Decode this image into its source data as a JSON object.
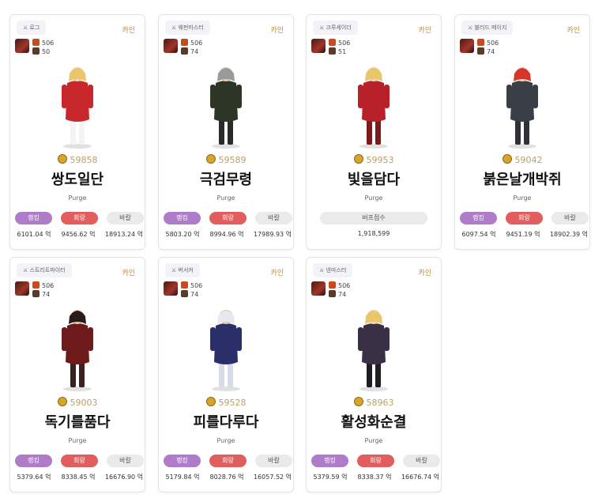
{
  "cards": [
    {
      "job": "로그",
      "adv_label": "카인",
      "fame": "506",
      "level": "50",
      "score": "59858",
      "name": "쌍도일단",
      "guild": "Purge",
      "buttons": [
        "랭킹",
        "회랑",
        "바칼"
      ],
      "values": [
        "6101.04 억",
        "9456.62 억",
        "18913.24 억"
      ],
      "colors": {
        "hair": "#e9c66a",
        "coat": "#c8272b",
        "skin": "#f3d2b8",
        "leg": "#f4f4f4"
      }
    },
    {
      "job": "웨펀마스터",
      "adv_label": "카인",
      "fame": "506",
      "level": "74",
      "score": "59589",
      "name": "극검무령",
      "guild": "Purge",
      "buttons": [
        "랭킹",
        "회랑",
        "바칼"
      ],
      "values": [
        "5803.20 억",
        "8994.96 억",
        "17989.93 억"
      ],
      "colors": {
        "hair": "#9a9a9a",
        "coat": "#2c3526",
        "skin": "#e9c9a8",
        "leg": "#2a2a2a"
      }
    },
    {
      "job": "크루세이더",
      "adv_label": "카인",
      "fame": "506",
      "level": "51",
      "score": "59953",
      "name": "빛을담다",
      "guild": "Purge",
      "buff_label": "버프점수",
      "buff_value": "1,918,599",
      "colors": {
        "hair": "#e9c66a",
        "coat": "#b8202a",
        "skin": "#f3d2b8",
        "leg": "#7a1a1a"
      }
    },
    {
      "job": "블러드 메이지",
      "adv_label": "카인",
      "fame": "506",
      "level": "74",
      "score": "59042",
      "name": "붉은날개박쥐",
      "guild": "Purge",
      "buttons": [
        "랭킹",
        "회랑",
        "바칼"
      ],
      "values": [
        "6097.54 억",
        "9451.19 억",
        "18902.39 억"
      ],
      "colors": {
        "hair": "#d8352a",
        "coat": "#3a3f47",
        "skin": "#f3d2b8",
        "leg": "#2e3238"
      }
    },
    {
      "job": "스트리트파이터",
      "adv_label": "카인",
      "fame": "506",
      "level": "74",
      "score": "59003",
      "name": "독기를품다",
      "guild": "Purge",
      "buttons": [
        "랭킹",
        "회랑",
        "바칼"
      ],
      "values": [
        "5379.64 억",
        "8338.45 억",
        "16676.90 억"
      ],
      "colors": {
        "hair": "#2a1a1a",
        "coat": "#6e1a1a",
        "skin": "#e9c9a8",
        "leg": "#3a2020"
      }
    },
    {
      "job": "버서커",
      "adv_label": "카인",
      "fame": "506",
      "level": "74",
      "score": "59528",
      "name": "피를다루다",
      "guild": "Purge",
      "buttons": [
        "랭킹",
        "회랑",
        "바칼"
      ],
      "values": [
        "5179.84 억",
        "8028.76 억",
        "16057.52 억"
      ],
      "colors": {
        "hair": "#e8e8f0",
        "coat": "#2a2f6a",
        "skin": "#e9c9a8",
        "leg": "#d8dbe8"
      }
    },
    {
      "job": "넨마스터",
      "adv_label": "카인",
      "fame": "506",
      "level": "74",
      "score": "58963",
      "name": "활성화순결",
      "guild": "Purge",
      "buttons": [
        "랭킹",
        "회랑",
        "바칼"
      ],
      "values": [
        "5379.59 억",
        "8338.37 억",
        "16676.74 억"
      ],
      "colors": {
        "hair": "#e9c66a",
        "coat": "#3a3046",
        "skin": "#f3d2b8",
        "leg": "#1e1e22"
      }
    }
  ]
}
